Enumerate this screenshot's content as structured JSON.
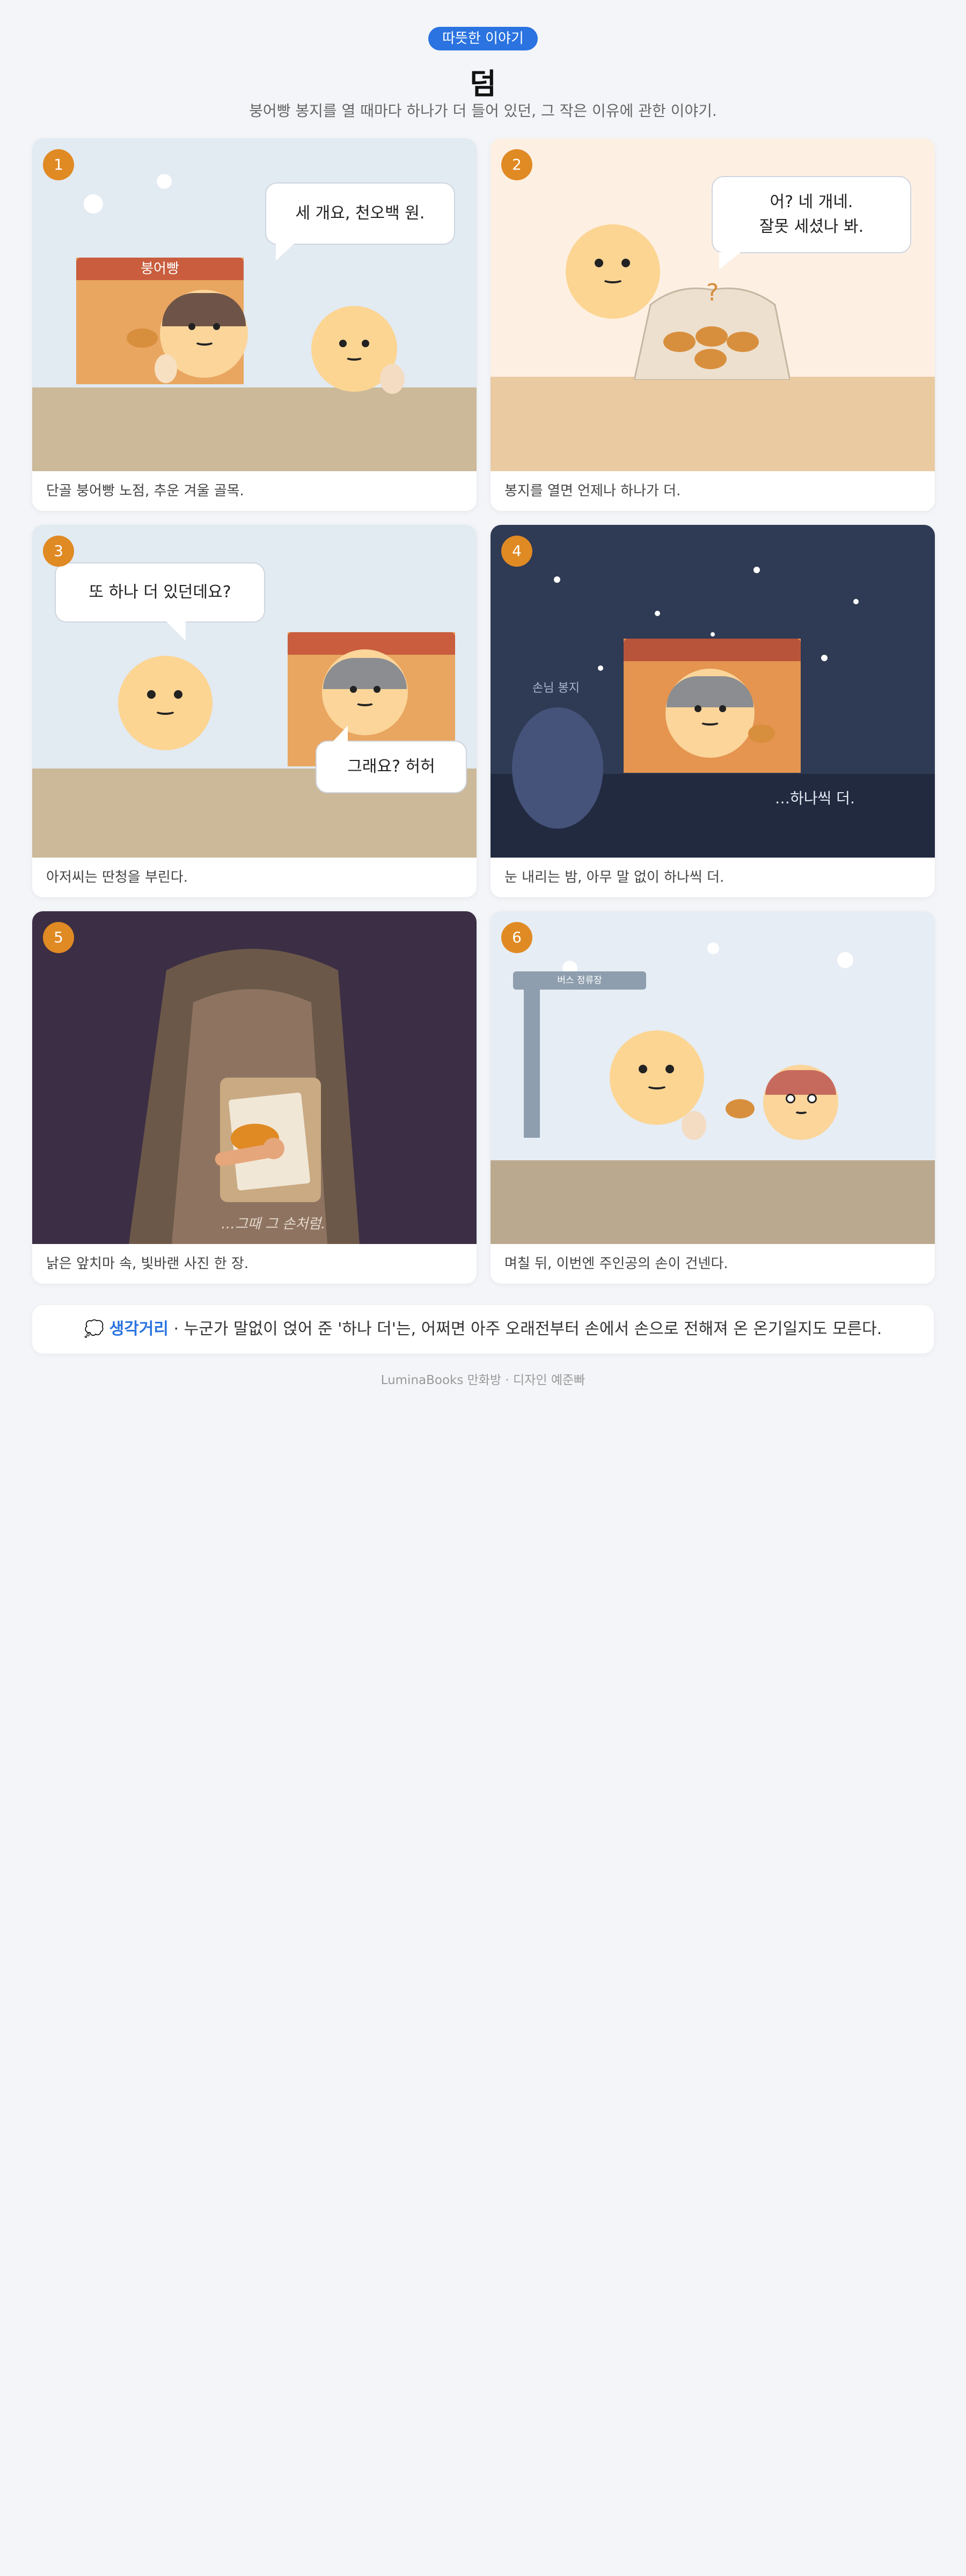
{
  "header": {
    "badge": "따뜻한 이야기",
    "title": "덤",
    "subtitle": "붕어빵 봉지를 열 때마다 하나가 더 들어 있던, 그 작은 이유에 관한 이야기."
  },
  "panels": [
    {
      "number": "1",
      "caption": "단골 붕어빵 노점, 추운 겨울 골목.",
      "sign": "붕어빵",
      "bubbles": [
        "세 개요, 천오백 원."
      ]
    },
    {
      "number": "2",
      "caption": "봉지를 열면 언제나 하나가 더.",
      "bubbles": [
        "어? 네 개네.",
        "잘못 세셨나 봐."
      ],
      "mark": "?"
    },
    {
      "number": "3",
      "caption": "아저씨는 딴청을 부린다.",
      "bubbles": [
        "또 하나 더 있던데요?",
        "그래요? 허허"
      ]
    },
    {
      "number": "4",
      "caption": "눈 내리는 밤, 아무 말 없이 하나씩 더.",
      "bag_label": "손님 봉지",
      "inner_text": "…하나씩 더."
    },
    {
      "number": "5",
      "caption": "낡은 앞치마 속, 빛바랜 사진 한 장.",
      "inner_text": "…그때 그 손처럼."
    },
    {
      "number": "6",
      "caption": "며칠 뒤, 이번엔 주인공의 손이 건넨다.",
      "sign": "버스 정류장"
    }
  ],
  "note": {
    "icon": "💭",
    "label": "생각거리",
    "text": " · 누군가 말없이 얹어 준 '하나 더'는, 어쩌면 아주 오래전부터 손에서 손으로 전해져 온 온기일지도 모른다."
  },
  "footer": "LuminaBooks 만화방 · 디자인 예준빠",
  "colors": {
    "accent": "#2a73e0",
    "badge_number": "#e08a24"
  }
}
